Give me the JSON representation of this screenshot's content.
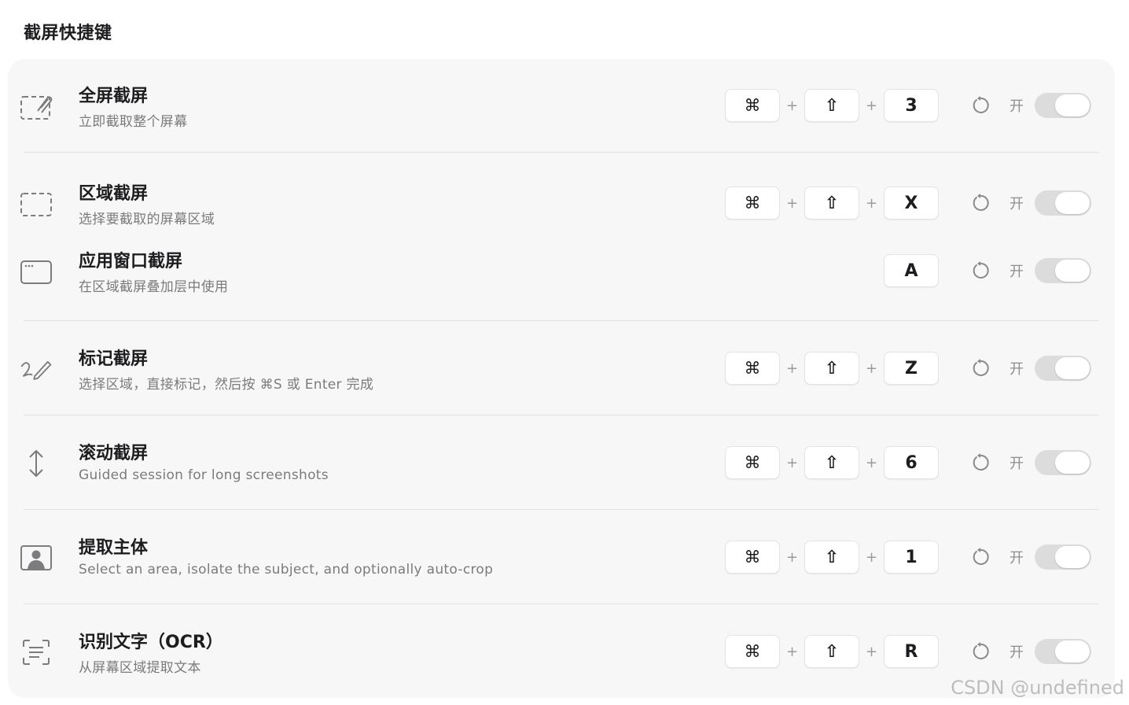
{
  "section_title": "截屏快捷键",
  "toggle_on_label": "开",
  "rows": [
    {
      "title": "全屏截屏",
      "desc": "立即截取整个屏幕",
      "icon": "fullscreen-capture-icon",
      "keys": [
        "⌘",
        "⇧",
        "3"
      ]
    },
    {
      "title": "区域截屏",
      "desc": "选择要截取的屏幕区域",
      "icon": "area-capture-icon",
      "keys": [
        "⌘",
        "⇧",
        "X"
      ]
    },
    {
      "title": "应用窗口截屏",
      "desc": "在区域截屏叠加层中使用",
      "icon": "window-capture-icon",
      "keys": [
        "A"
      ]
    },
    {
      "title": "标记截屏",
      "desc": "选择区域，直接标记，然后按 ⌘S 或 Enter 完成",
      "icon": "markup-pen-icon",
      "keys": [
        "⌘",
        "⇧",
        "Z"
      ]
    },
    {
      "title": "滚动截屏",
      "desc": "Guided session for long screenshots",
      "icon": "scroll-arrows-icon",
      "keys": [
        "⌘",
        "⇧",
        "6"
      ]
    },
    {
      "title": "提取主体",
      "desc": "Select an area, isolate the subject, and optionally auto-crop",
      "icon": "subject-portrait-icon",
      "keys": [
        "⌘",
        "⇧",
        "1"
      ]
    },
    {
      "title": "识别文字（OCR）",
      "desc": "从屏幕区域提取文本",
      "icon": "text-scan-icon",
      "keys": [
        "⌘",
        "⇧",
        "R"
      ]
    }
  ],
  "toggles": [
    true,
    true,
    true,
    true,
    true,
    true,
    true
  ],
  "watermark": "CSDN @undefined"
}
